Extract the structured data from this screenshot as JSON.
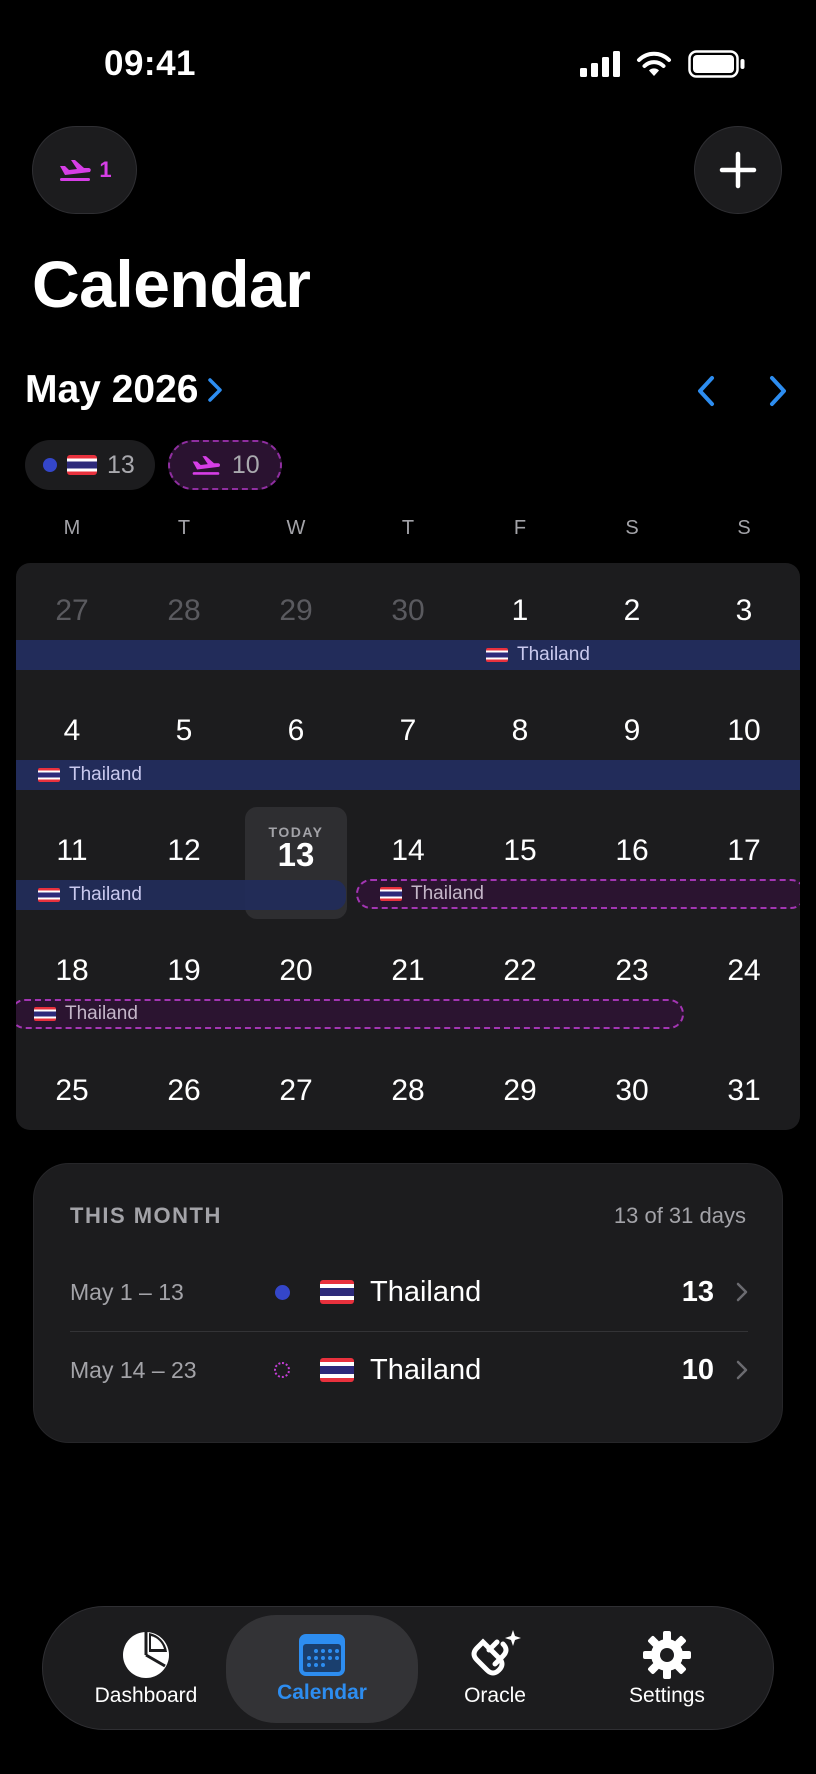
{
  "status_bar": {
    "time": "09:41"
  },
  "header": {
    "trip_count": "1",
    "title": "Calendar"
  },
  "month_nav": {
    "label": "May 2026"
  },
  "chips": [
    {
      "flag": "🇹🇭",
      "count": "13",
      "style": "completed"
    },
    {
      "count": "10",
      "style": "planned"
    }
  ],
  "weekdays": [
    "M",
    "T",
    "W",
    "T",
    "F",
    "S",
    "S"
  ],
  "calendar": {
    "weeks": [
      [
        "27",
        "28",
        "29",
        "30",
        "1",
        "2",
        "3"
      ],
      [
        "4",
        "5",
        "6",
        "7",
        "8",
        "9",
        "10"
      ],
      [
        "11",
        "12",
        "13",
        "14",
        "15",
        "16",
        "17"
      ],
      [
        "18",
        "19",
        "20",
        "21",
        "22",
        "23",
        "24"
      ],
      [
        "25",
        "26",
        "27",
        "28",
        "29",
        "30",
        "31"
      ]
    ],
    "today": {
      "label": "TODAY",
      "day": "13"
    },
    "bar_label": "Thailand"
  },
  "summary": {
    "heading": "THIS MONTH",
    "days_text": "13 of 31 days",
    "rows": [
      {
        "range": "May 1 – 13",
        "country": "Thailand",
        "count": "13"
      },
      {
        "range": "May 14 – 23",
        "country": "Thailand",
        "count": "10"
      }
    ]
  },
  "tabs": [
    {
      "label": "Dashboard",
      "icon": "pie-chart-icon"
    },
    {
      "label": "Calendar",
      "icon": "calendar-icon",
      "active": true
    },
    {
      "label": "Oracle",
      "icon": "oracle-sparkle-icon"
    },
    {
      "label": "Settings",
      "icon": "gear-icon"
    }
  ],
  "colors": {
    "accent": "#2d8df0",
    "completed": "#3446c9",
    "planned": "#c43ed6",
    "background": "#000000",
    "card": "#1c1c1e"
  }
}
